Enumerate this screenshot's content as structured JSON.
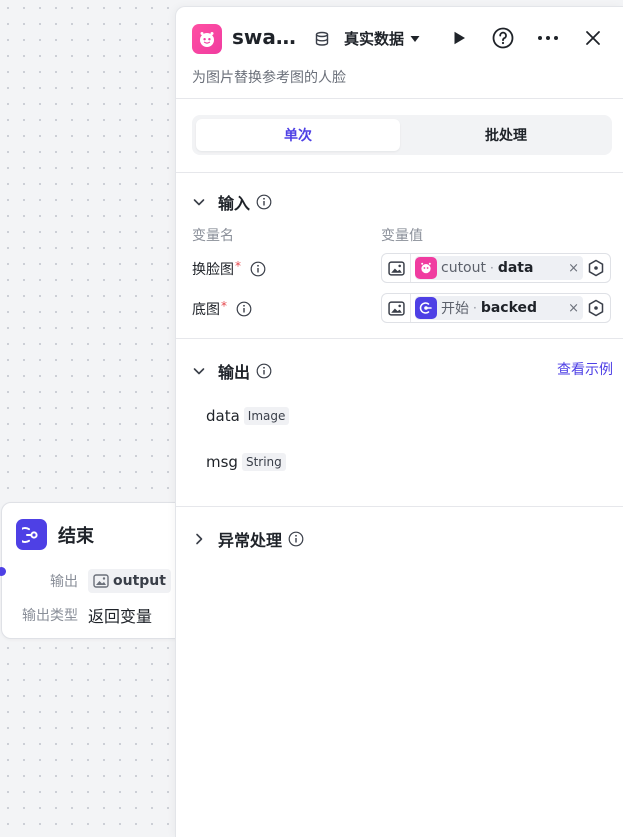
{
  "end_node": {
    "title": "结束",
    "output_label": "输出",
    "output_value": "output",
    "output_type_label": "输出类型",
    "output_type_value": "返回变量"
  },
  "panel": {
    "title": "swap…",
    "data_source": "真实数据",
    "description": "为图片替换参考图的人脸",
    "tabs": {
      "single": "单次",
      "batch": "批处理"
    },
    "input": {
      "title": "输入",
      "col_name": "变量名",
      "col_value": "变量值",
      "params": [
        {
          "name": "换脸图",
          "required": "*",
          "source": "cutout",
          "sep": "·",
          "variable": "data",
          "clear": "×"
        },
        {
          "name": "底图",
          "required": "*",
          "source": "开始",
          "sep": "·",
          "variable": "backed",
          "clear": "×"
        }
      ]
    },
    "output": {
      "title": "输出",
      "example_link": "查看示例",
      "fields": [
        {
          "name": "data",
          "type": "Image"
        },
        {
          "name": "msg",
          "type": "String"
        }
      ]
    },
    "exception": {
      "title": "异常处理"
    }
  },
  "colors": {
    "accent": "#4e40e5",
    "app_icon": "#f03ca0",
    "required": "#e5484d"
  },
  "icons": {
    "app": "robot-face-icon",
    "data_source": "database-icon",
    "run": "play-icon",
    "help": "help-circle-icon",
    "more": "more-dots-icon",
    "close": "close-icon",
    "end_node": "end-exit-icon"
  }
}
